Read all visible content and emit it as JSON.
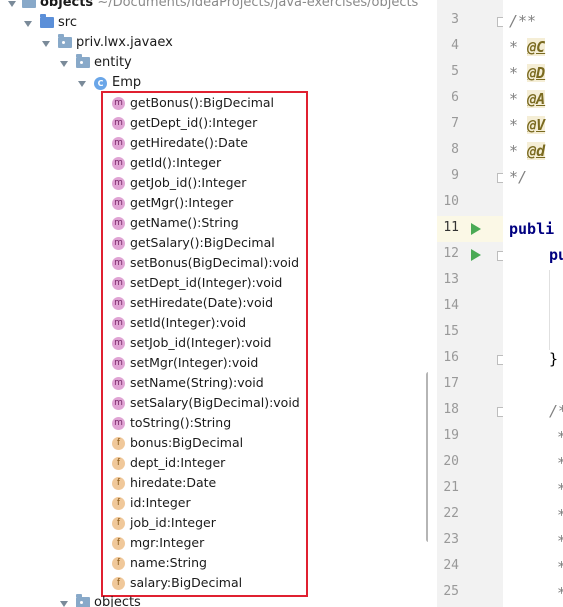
{
  "tree": {
    "root": {
      "name": "objects",
      "path": "~/Documents/IdeaProjects/java-exercises/objects"
    },
    "src": "src",
    "package": "priv.lwx.javaex",
    "entity": "entity",
    "class": "Emp",
    "class_icon_letter": "C",
    "members": [
      {
        "kind": "m",
        "text": "getBonus():BigDecimal"
      },
      {
        "kind": "m",
        "text": "getDept_id():Integer"
      },
      {
        "kind": "m",
        "text": "getHiredate():Date"
      },
      {
        "kind": "m",
        "text": "getId():Integer"
      },
      {
        "kind": "m",
        "text": "getJob_id():Integer"
      },
      {
        "kind": "m",
        "text": "getMgr():Integer"
      },
      {
        "kind": "m",
        "text": "getName():String"
      },
      {
        "kind": "m",
        "text": "getSalary():BigDecimal"
      },
      {
        "kind": "m",
        "text": "setBonus(BigDecimal):void"
      },
      {
        "kind": "m",
        "text": "setDept_id(Integer):void"
      },
      {
        "kind": "m",
        "text": "setHiredate(Date):void"
      },
      {
        "kind": "m",
        "text": "setId(Integer):void"
      },
      {
        "kind": "m",
        "text": "setJob_id(Integer):void"
      },
      {
        "kind": "m",
        "text": "setMgr(Integer):void"
      },
      {
        "kind": "m",
        "text": "setName(String):void"
      },
      {
        "kind": "m",
        "text": "setSalary(BigDecimal):void"
      },
      {
        "kind": "m",
        "text": "toString():String"
      },
      {
        "kind": "f",
        "text": "bonus:BigDecimal"
      },
      {
        "kind": "f",
        "text": "dept_id:Integer"
      },
      {
        "kind": "f",
        "text": "hiredate:Date"
      },
      {
        "kind": "f",
        "text": "id:Integer"
      },
      {
        "kind": "f",
        "text": "job_id:Integer"
      },
      {
        "kind": "f",
        "text": "mgr:Integer"
      },
      {
        "kind": "f",
        "text": "name:String"
      },
      {
        "kind": "f",
        "text": "salary:BigDecimal"
      }
    ],
    "bottom_item": "objects"
  },
  "editor": {
    "line_numbers": [
      "3",
      "4",
      "5",
      "6",
      "7",
      "8",
      "9",
      "10",
      "11",
      "12",
      "13",
      "14",
      "15",
      "16",
      "17",
      "18",
      "19",
      "20",
      "21",
      "22",
      "23",
      "24",
      "25"
    ],
    "code": {
      "l3": "/**",
      "l4_star": " * ",
      "l4_tag": "@C",
      "l5_star": " * ",
      "l5_tag": "@D",
      "l6_star": " * ",
      "l6_tag": "@A",
      "l7_star": " * ",
      "l7_tag": "@V",
      "l8_star": " * ",
      "l8_tag": "@d",
      "l9": " */",
      "l11": "publi",
      "l12": "pu",
      "l16": "}",
      "l18": "/*",
      "cont": "*"
    }
  },
  "colors": {
    "highlight": "#e02030",
    "run": "#4aaa55",
    "method_icon": "#e0a4d4",
    "field_icon": "#f0c89a"
  }
}
